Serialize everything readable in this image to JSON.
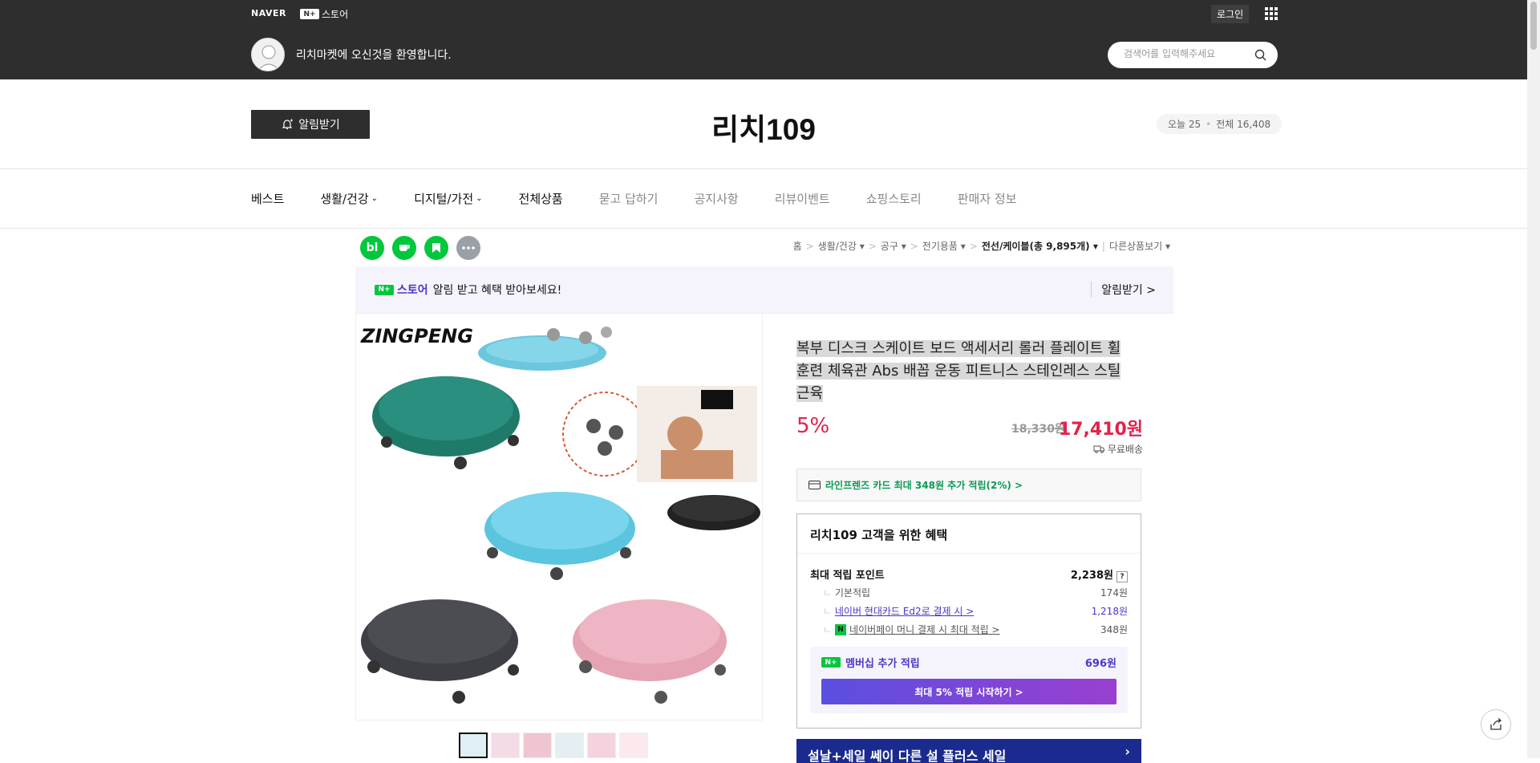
{
  "topbar": {
    "naver": "NAVER",
    "store_badge": "N+",
    "store_label": "스토어",
    "login": "로그인",
    "welcome": "리치마켓에 오신것을 환영합니다.",
    "search_placeholder": "검색어를 입력해주세요"
  },
  "header": {
    "alarm_button": "알림받기",
    "store_title": "리치109",
    "visits_today": "오늘 25",
    "visits_total": "전체 16,408"
  },
  "nav": {
    "items": [
      {
        "label": "베스트"
      },
      {
        "label": "생활/건강"
      },
      {
        "label": "디지털/가전"
      },
      {
        "label": "전체상품"
      },
      {
        "label": "묻고 답하기"
      },
      {
        "label": "공지사항"
      },
      {
        "label": "리뷰이벤트"
      },
      {
        "label": "쇼핑스토리"
      },
      {
        "label": "판매자 정보"
      }
    ]
  },
  "quick_icons": {
    "blog": "bl",
    "colors": {
      "blog": "#00c73c",
      "talk": "#00c73c",
      "keep": "#00c73c",
      "more": "#9aa0a6"
    }
  },
  "breadcrumb": {
    "home": "홈",
    "c1": "생활/건강",
    "c2": "공구",
    "c3": "전기용품",
    "current": "전선/케이블(총 9,895개)",
    "other": "다른상품보기"
  },
  "banner": {
    "store_badge": "N+",
    "store_label": "스토어",
    "message": "알림 받고 혜택 받아보세요!",
    "right": "알림받기 >"
  },
  "product": {
    "brand_logo": "ZINGPENG",
    "title": "복부 디스크 스케이트 보드 액세서리 롤러 플레이트 휠 훈련 체육관 Abs 배꼽 운동 피트니스 스테인레스 스틸 근육",
    "discount": "5%",
    "original_price": "18,330원",
    "price": "17,410원",
    "shipping": "무료배송",
    "card_offer": "라인프렌즈 카드 최대 348원 추가 적립(2%) >"
  },
  "benefit": {
    "heading": "리치109 고객을 위한 혜택",
    "max_points_label": "최대 적립 포인트",
    "max_points_value": "2,238원",
    "q": "?",
    "basic_label": "기본적립",
    "basic_value": "174원",
    "card_label": "네이버 현대카드 Ed2로 결제 시 >",
    "card_value": "1,218원",
    "pay_badge": "N",
    "pay_label": "네이버페이 머니 결제 시 최대 적립 >",
    "pay_value": "348원",
    "member_badge": "N+",
    "member_label": "멤버십 추가 적립",
    "member_value": "696원",
    "member_button": "최대 5% 적립 시작하기 >"
  },
  "promo": {
    "text": "설날+세일    쎄이 다른 설 플러스 세일"
  }
}
